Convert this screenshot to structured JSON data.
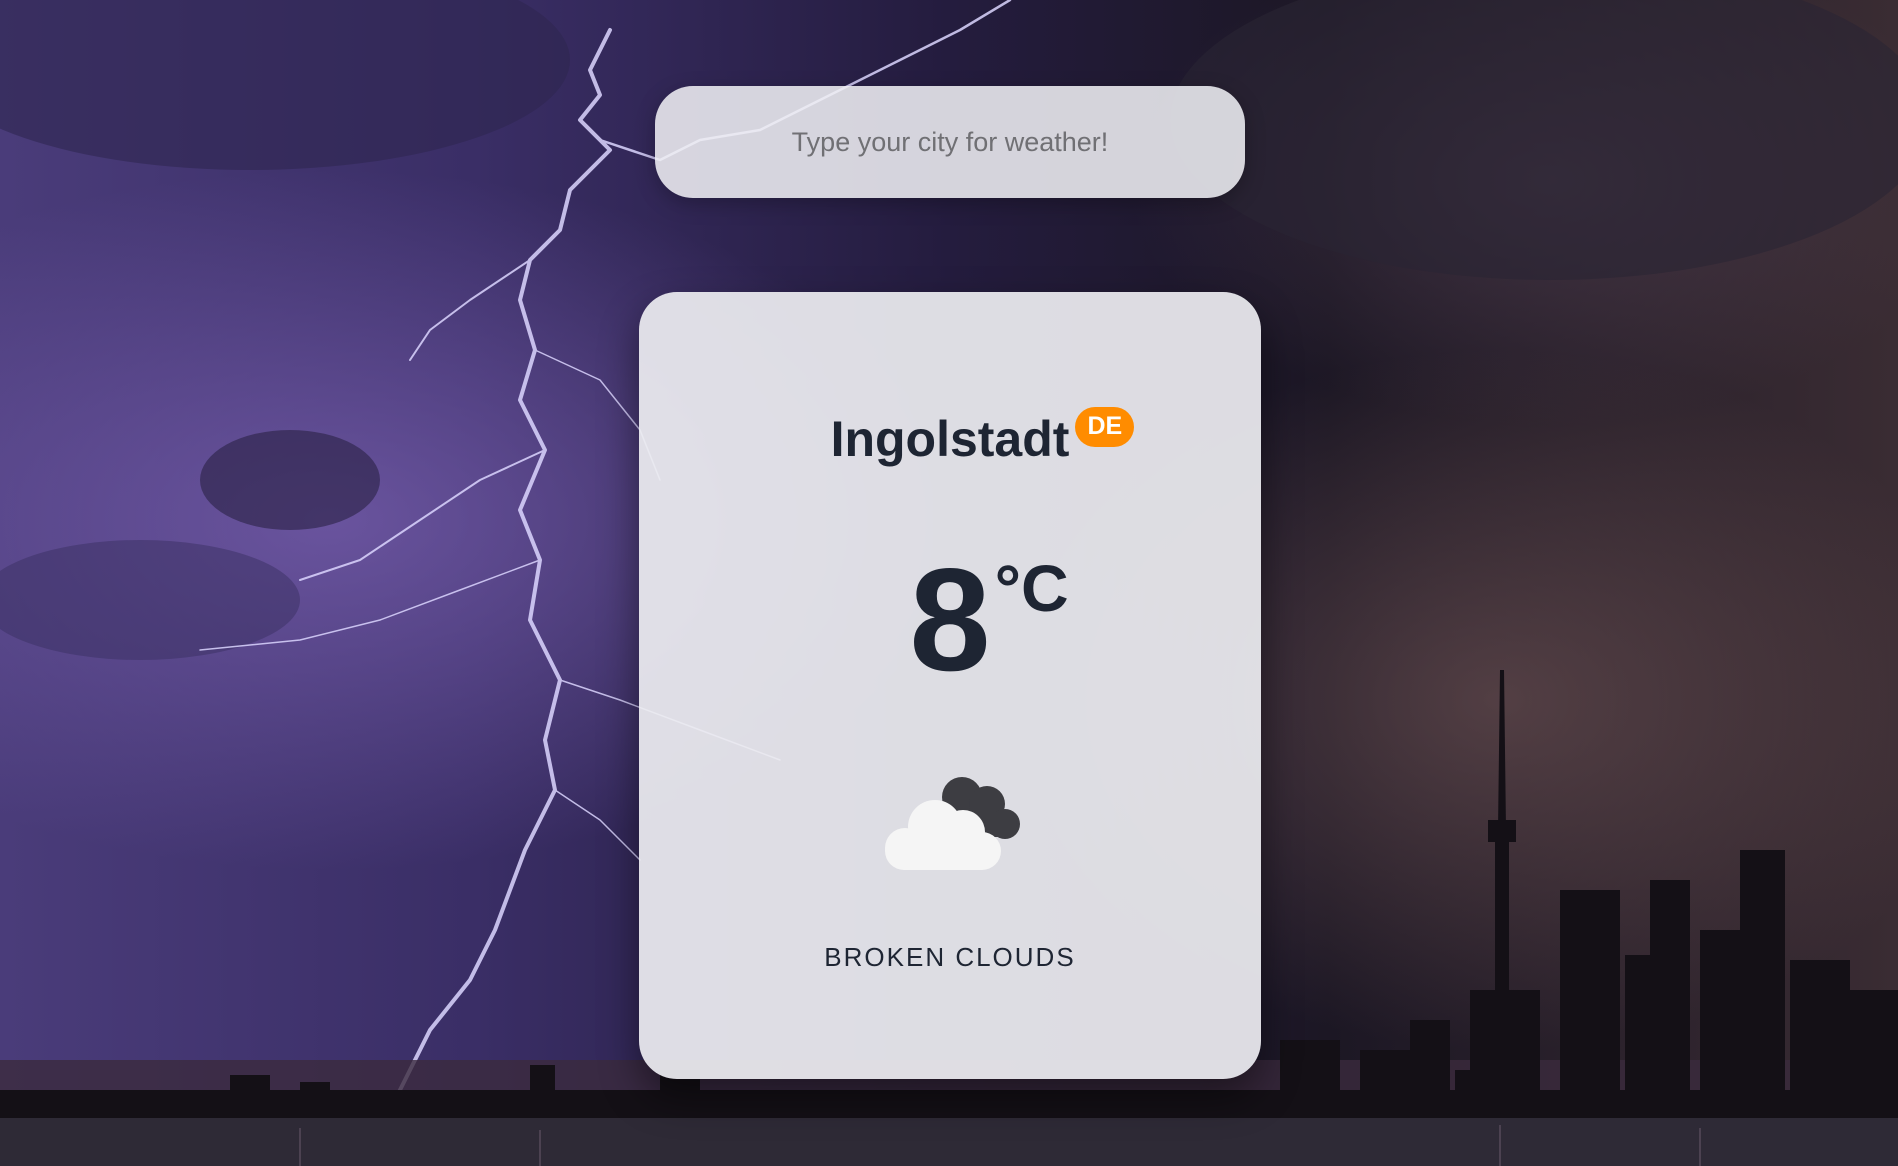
{
  "search": {
    "placeholder": "Type your city for weather!",
    "value": ""
  },
  "weather": {
    "city": "Ingolstadt",
    "country": "DE",
    "temperature": "8",
    "unit": "°C",
    "description": "BROKEN CLOUDS",
    "icon": "broken-clouds-icon"
  },
  "colors": {
    "badge": "#ff8c00",
    "text": "#1e2533",
    "card": "#ececf0"
  }
}
